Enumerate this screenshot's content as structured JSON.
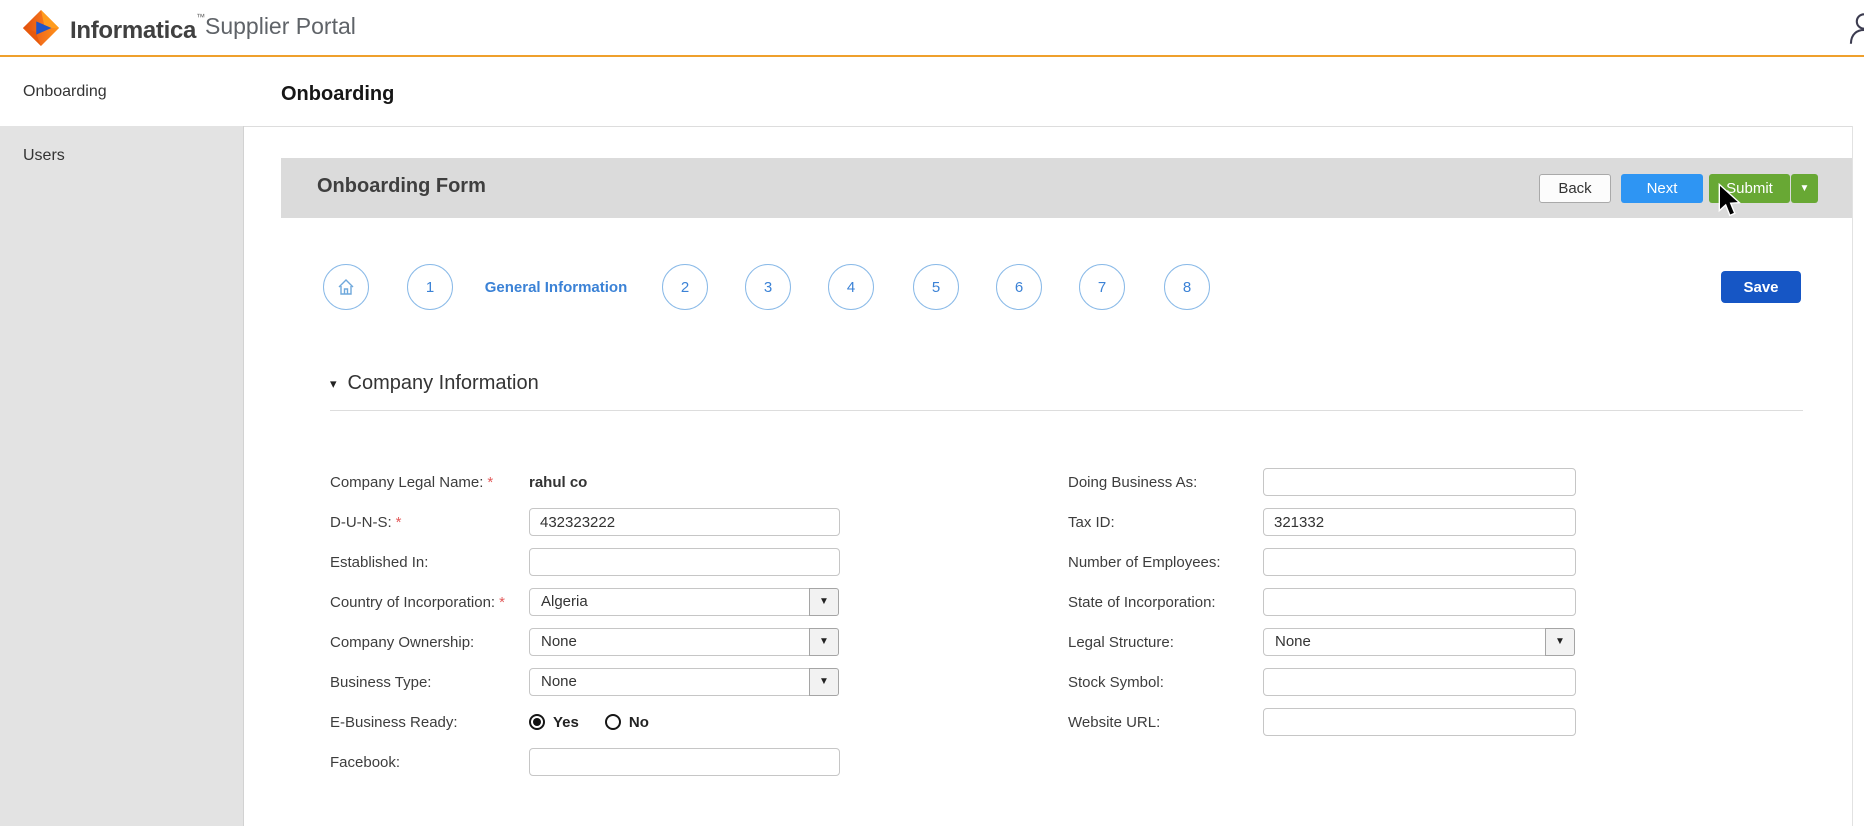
{
  "header": {
    "brand": "Informatica",
    "brand_mark": "™",
    "product": "Supplier Portal"
  },
  "sidebar": {
    "items": [
      {
        "label": "Onboarding",
        "active": true
      },
      {
        "label": "Users",
        "active": false
      }
    ]
  },
  "page": {
    "title": "Onboarding"
  },
  "panel": {
    "title": "Onboarding Form",
    "back_label": "Back",
    "next_label": "Next",
    "submit_label": "Submit"
  },
  "wizard": {
    "steps": [
      "1",
      "2",
      "3",
      "4",
      "5",
      "6",
      "7",
      "8"
    ],
    "current_step_label": "General Information"
  },
  "save_label": "Save",
  "section": {
    "title": "Company Information"
  },
  "required_mark": "*",
  "form": {
    "left": [
      {
        "label": "Company Legal Name:",
        "required": true,
        "type": "static",
        "value": "rahul co"
      },
      {
        "label": "D-U-N-S:",
        "required": true,
        "type": "text",
        "value": "432323222"
      },
      {
        "label": "Established In:",
        "required": false,
        "type": "text",
        "value": ""
      },
      {
        "label": "Country of Incorporation:",
        "required": true,
        "type": "select",
        "value": "Algeria"
      },
      {
        "label": "Company Ownership:",
        "required": false,
        "type": "select",
        "value": "None"
      },
      {
        "label": "Business Type:",
        "required": false,
        "type": "select",
        "value": "None"
      },
      {
        "label": "E-Business Ready:",
        "required": false,
        "type": "radio",
        "options": [
          "Yes",
          "No"
        ],
        "selected": "Yes"
      },
      {
        "label": "Facebook:",
        "required": false,
        "type": "text",
        "value": ""
      }
    ],
    "right": [
      {
        "label": "Doing Business As:",
        "required": false,
        "type": "text",
        "value": ""
      },
      {
        "label": "Tax ID:",
        "required": false,
        "type": "text",
        "value": "321332"
      },
      {
        "label": "Number of Employees:",
        "required": false,
        "type": "text",
        "value": ""
      },
      {
        "label": "State of Incorporation:",
        "required": false,
        "type": "text",
        "value": ""
      },
      {
        "label": "Legal Structure:",
        "required": false,
        "type": "select",
        "value": "None"
      },
      {
        "label": "Stock Symbol:",
        "required": false,
        "type": "text",
        "value": ""
      },
      {
        "label": "Website URL:",
        "required": false,
        "type": "text",
        "value": ""
      }
    ]
  },
  "colors": {
    "header_accent": "#EFA02C",
    "next_button": "#2E95F3",
    "submit_button": "#68A834",
    "save_button": "#1656C5",
    "step_circle_border": "#8ABAE8",
    "step_text": "#3B82D6",
    "required_asterisk": "#E25A5A"
  }
}
